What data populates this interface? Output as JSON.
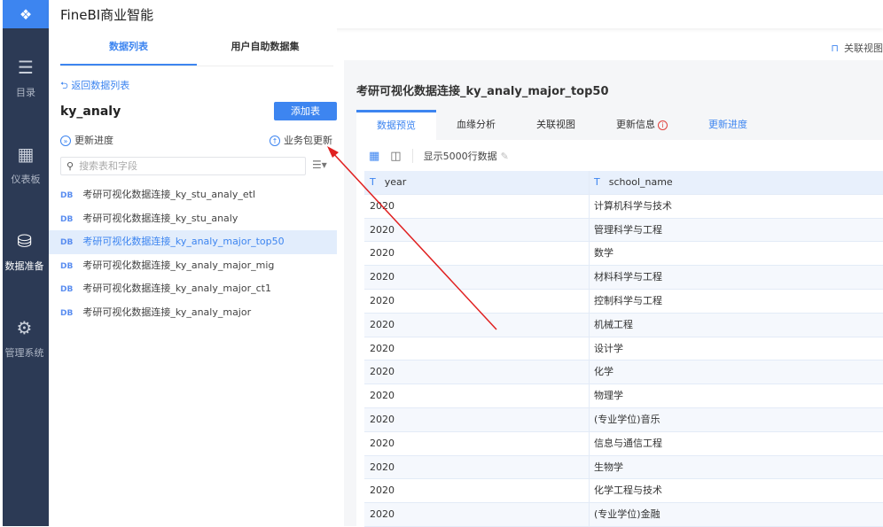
{
  "app": {
    "title": "FineBI商业智能"
  },
  "sidebar": {
    "items": [
      {
        "label": "目录",
        "icon": "list-icon"
      },
      {
        "label": "仪表板",
        "icon": "dashboard-icon"
      },
      {
        "label": "数据准备",
        "icon": "database-icon",
        "active": true
      },
      {
        "label": "管理系统",
        "icon": "gear-icon"
      }
    ]
  },
  "topbar": {
    "relation_view": "关联视图"
  },
  "left": {
    "tabs": [
      "数据列表",
      "用户自助数据集"
    ],
    "back": "返回数据列表",
    "package": "ky_analy",
    "add_table": "添加表",
    "update_progress": "更新进度",
    "package_update": "业务包更新",
    "search_placeholder": "搜索表和字段",
    "tables": [
      "考研可视化数据连接_ky_stu_analy_etl",
      "考研可视化数据连接_ky_stu_analy",
      "考研可视化数据连接_ky_analy_major_top50",
      "考研可视化数据连接_ky_analy_major_mig",
      "考研可视化数据连接_ky_analy_major_ct1",
      "考研可视化数据连接_ky_analy_major"
    ],
    "selected_index": 2,
    "db_badge": "DB"
  },
  "right": {
    "title": "考研可视化数据连接_ky_analy_major_top50",
    "tabs": [
      "数据预览",
      "血缘分析",
      "关联视图",
      "更新信息",
      "更新进度"
    ],
    "row_limit": "显示5000行数据",
    "columns": [
      "year",
      "school_name"
    ],
    "rows": [
      [
        "2020",
        "计算机科学与技术"
      ],
      [
        "2020",
        "管理科学与工程"
      ],
      [
        "2020",
        "数学"
      ],
      [
        "2020",
        "材料科学与工程"
      ],
      [
        "2020",
        "控制科学与工程"
      ],
      [
        "2020",
        "机械工程"
      ],
      [
        "2020",
        "设计学"
      ],
      [
        "2020",
        "化学"
      ],
      [
        "2020",
        "物理学"
      ],
      [
        "2020",
        "(专业学位)音乐"
      ],
      [
        "2020",
        "信息与通信工程"
      ],
      [
        "2020",
        "生物学"
      ],
      [
        "2020",
        "化学工程与技术"
      ],
      [
        "2020",
        "(专业学位)金融"
      ]
    ]
  },
  "colors": {
    "accent": "#3d85f0",
    "sidebar": "#2c3a55",
    "annotation": "#e02020"
  }
}
